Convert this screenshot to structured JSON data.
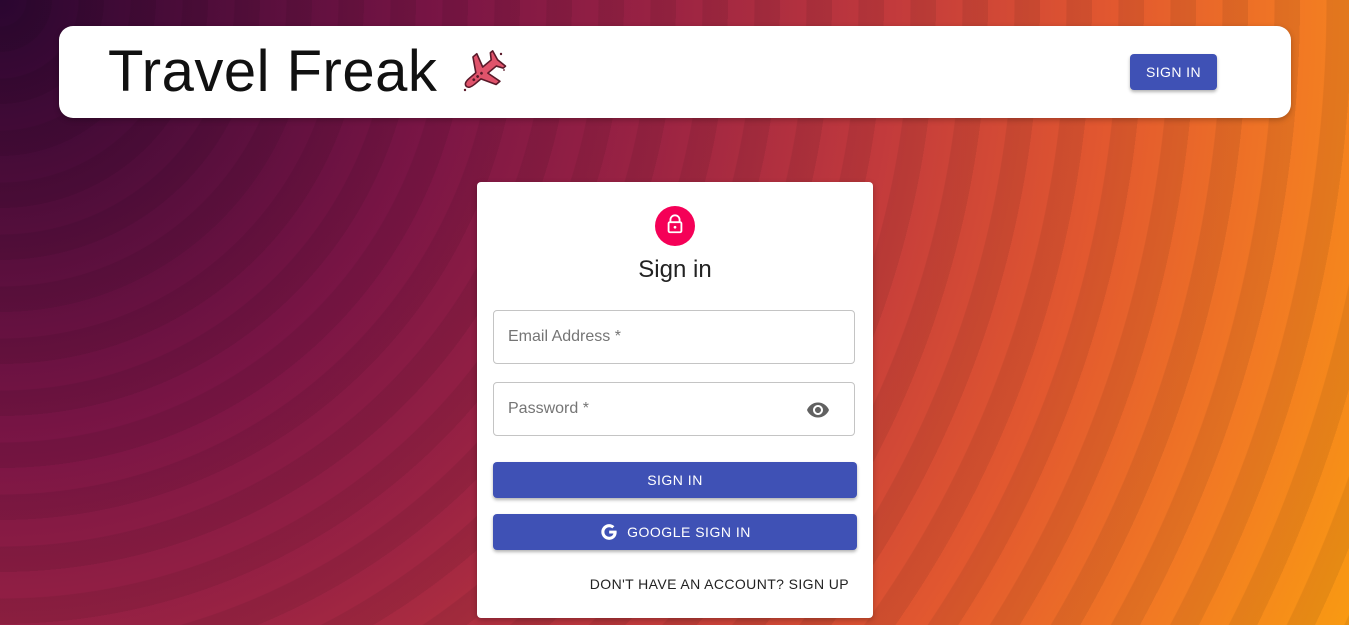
{
  "header": {
    "title": "Travel Freak",
    "logo_icon": "airplane-icon",
    "signin_label": "SIGN IN",
    "accent_color": "#3f51b5"
  },
  "signin_card": {
    "avatar_icon": "lock-icon",
    "avatar_color": "#f50057",
    "title": "Sign in",
    "email": {
      "placeholder": "Email Address *",
      "value": ""
    },
    "password": {
      "placeholder": "Password *",
      "value": "",
      "toggle_icon": "eye-icon"
    },
    "signin_button_label": "SIGN IN",
    "google_button": {
      "icon": "google-icon",
      "label": "GOOGLE SIGN IN"
    },
    "signup_link_label": "DON'T HAVE AN ACCOUNT? SIGN UP"
  }
}
